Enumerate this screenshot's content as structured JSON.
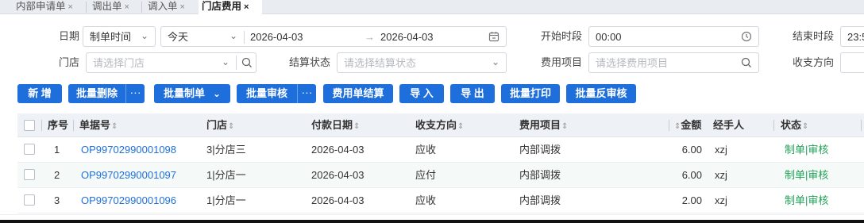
{
  "tabs": [
    {
      "label": "内部申请单",
      "close": "×"
    },
    {
      "label": "调出单",
      "close": "×"
    },
    {
      "label": "调入单",
      "close": "×"
    },
    {
      "label": "门店费用",
      "close": "×",
      "active": true
    }
  ],
  "filters": {
    "date_label": "日期",
    "date_type": "制单时间",
    "date_preset": "今天",
    "date_start": "2026-04-03",
    "date_arrow": "→",
    "date_end": "2026-04-03",
    "start_time_label": "开始时段",
    "start_time_value": "00:00",
    "end_time_label": "结束时段",
    "end_time_value": "23:5",
    "store_label": "门店",
    "store_placeholder": "请选择门店",
    "settle_label": "结算状态",
    "settle_placeholder": "请选择结算状态",
    "expense_label": "费用项目",
    "expense_placeholder": "请选择费用项目",
    "direction_label": "收支方向"
  },
  "toolbar": {
    "add": "新 增",
    "batch_delete": "批量删除",
    "batch_create": "批量制单",
    "batch_review": "批量审核",
    "settle": "费用单结算",
    "import": "导 入",
    "export": "导 出",
    "batch_print": "批量打印",
    "batch_unreview": "批量反审核",
    "more": "···"
  },
  "table": {
    "headers": {
      "seq": "序号",
      "doc_no": "单据号",
      "store": "门店",
      "pay_date": "付款日期",
      "direction": "收支方向",
      "expense": "费用项目",
      "amount": "金额",
      "handler": "经手人",
      "status": "状态",
      "sort_icon": "⇕"
    },
    "rows": [
      {
        "seq": "1",
        "doc_no": "OP99702990001098",
        "store": "3|分店三",
        "pay_date": "2026-04-03",
        "direction": "应收",
        "expense": "内部调拨",
        "amount": "6.00",
        "handler": "xzj",
        "status": "制单|审核"
      },
      {
        "seq": "2",
        "doc_no": "OP99702990001097",
        "store": "1|分店一",
        "pay_date": "2026-04-03",
        "direction": "应付",
        "expense": "内部调拨",
        "amount": "6.00",
        "handler": "xzj",
        "status": "制单|审核"
      },
      {
        "seq": "3",
        "doc_no": "OP99702990001096",
        "store": "1|分店一",
        "pay_date": "2026-04-03",
        "direction": "应收",
        "expense": "内部调拨",
        "amount": "2.00",
        "handler": "xzj",
        "status": "制单|审核"
      }
    ]
  },
  "colors": {
    "primary": "#1e6fdc",
    "status_green": "#22a35a"
  }
}
